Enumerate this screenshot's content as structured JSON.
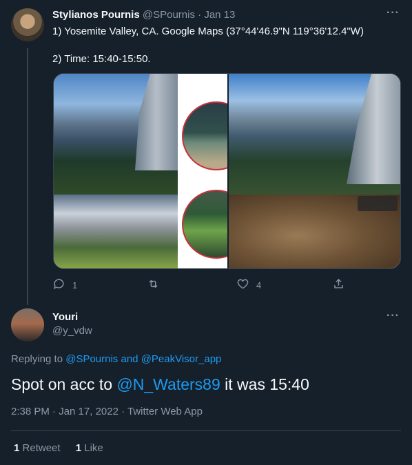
{
  "tweet1": {
    "name": "Stylianos Pournis",
    "handle": "@SPournis",
    "sep": "·",
    "date": "Jan 13",
    "line1": "1) Yosemite Valley, CA. Google Maps (37°44'46.9\"N 119°36'12.4\"W)",
    "line2": "2) Time: 15:40-15:50.",
    "more": "···",
    "reply_count": "1",
    "like_count": "4"
  },
  "reply": {
    "name": "Youri",
    "handle": "@y_vdw",
    "more": "···",
    "replying_prefix": "Replying to",
    "replying_user1": "@SPournis",
    "replying_and": "and",
    "replying_user2": "@PeakVisor_app",
    "text_before": "Spot on acc to ",
    "mention": "@N_Waters89",
    "text_after": " it was 15:40",
    "meta": "2:38 PM · Jan 17, 2022 · Twitter Web App",
    "retweets_count": "1",
    "retweets_label": "Retweet",
    "likes_count": "1",
    "likes_label": "Like"
  },
  "icons": {
    "reply": "reply-icon",
    "retweet": "retweet-icon",
    "like": "heart-icon",
    "share": "share-icon"
  },
  "colors": {
    "background": "#15202b",
    "link": "#1d9bf0",
    "muted": "#8b98a5",
    "border": "#38444d"
  }
}
